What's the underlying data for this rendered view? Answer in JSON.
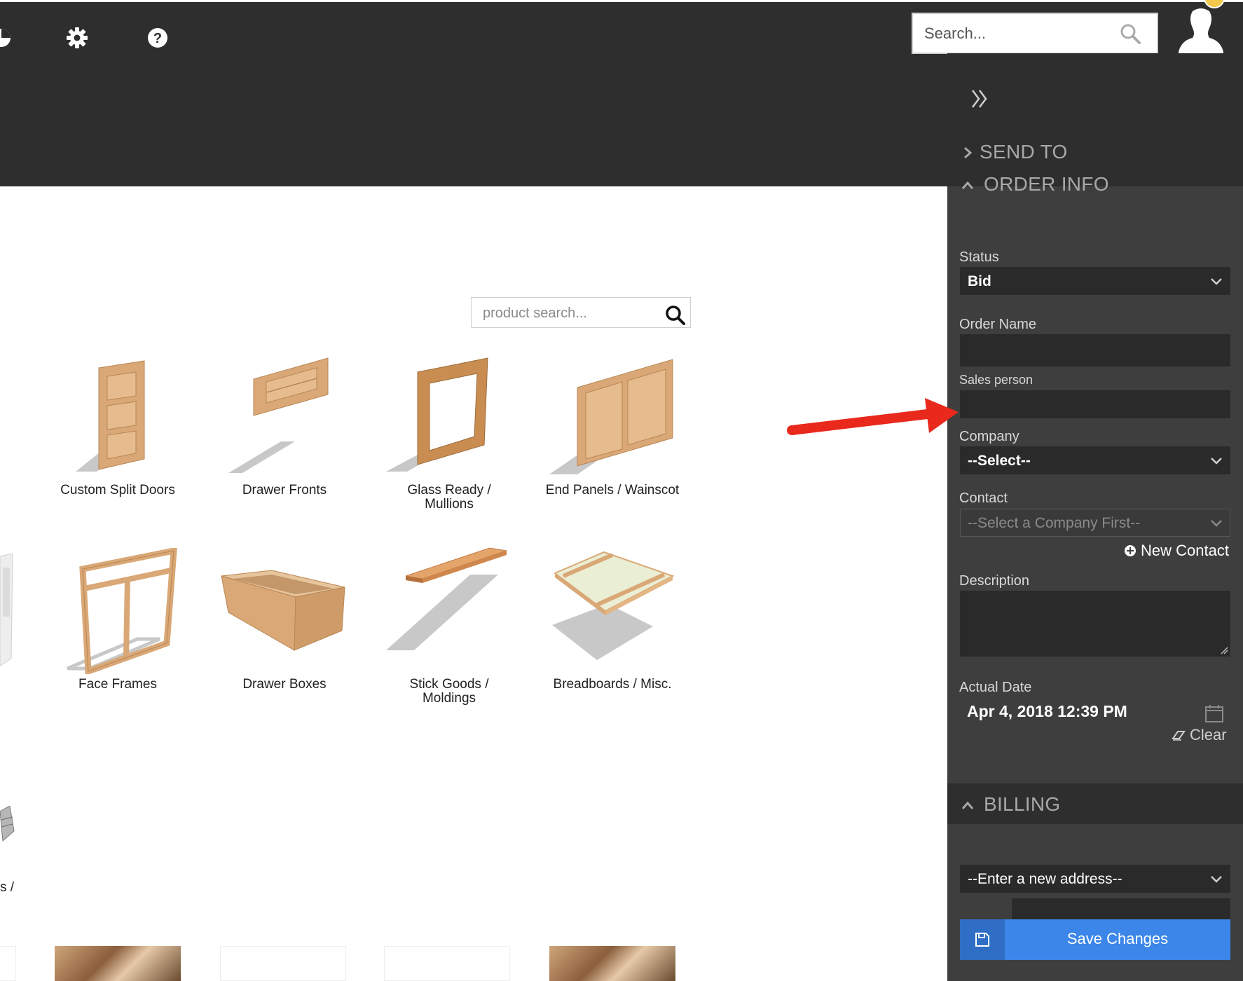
{
  "header": {
    "search_placeholder": "Search...",
    "icons": [
      "chart-icon",
      "gear-icon",
      "help-icon",
      "search-icon",
      "user-icon"
    ]
  },
  "panel": {
    "sections": {
      "send_to": "SEND TO",
      "order_info": "ORDER INFO",
      "billing": "BILLING"
    },
    "fields": {
      "status_label": "Status",
      "status_value": "Bid",
      "order_name_label": "Order Name",
      "sales_person_label": "Sales person",
      "company_label": "Company",
      "company_value": "--Select--",
      "contact_label": "Contact",
      "contact_value": "--Select a Company First--",
      "new_contact": "New Contact",
      "description_label": "Description",
      "actual_date_label": "Actual Date",
      "actual_date_value": "Apr  4, 2018 12:39 PM",
      "clear_label": "Clear",
      "billing_address_value": "--Enter a new address--"
    },
    "save_label": "Save Changes"
  },
  "catalog": {
    "search_placeholder": "product search...",
    "row1": [
      {
        "line1": "Custom Split Doors",
        "line2": ""
      },
      {
        "line1": "Drawer Fronts",
        "line2": ""
      },
      {
        "line1": "Glass Ready /",
        "line2": "Mullions"
      },
      {
        "line1": "End Panels / Wainscot",
        "line2": ""
      }
    ],
    "row2": [
      {
        "line1": "Face Frames",
        "line2": ""
      },
      {
        "line1": "Drawer Boxes",
        "line2": ""
      },
      {
        "line1": "Stick Goods /",
        "line2": "Moldings"
      },
      {
        "line1": "Breadboards / Misc.",
        "line2": ""
      }
    ],
    "partial_left_label": "s /"
  },
  "colors": {
    "header_bg": "#2e2e2e",
    "panel_bg": "#3e3e3e",
    "field_bg": "#2a2a2a",
    "accent_blue": "#3b86e8",
    "arrow_red": "#e8291c",
    "wood": "#d9a876"
  }
}
